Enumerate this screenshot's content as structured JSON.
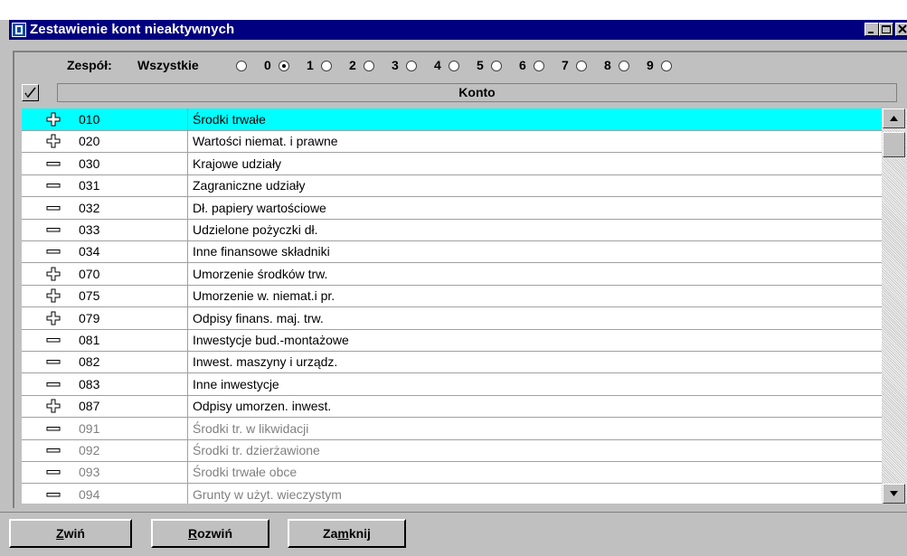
{
  "window": {
    "title": "Zestawienie kont nieaktywnych"
  },
  "filter": {
    "label": "Zespół:",
    "options": [
      {
        "label": "Wszystkie",
        "selected": false
      },
      {
        "label": "0",
        "selected": true
      },
      {
        "label": "1",
        "selected": false
      },
      {
        "label": "2",
        "selected": false
      },
      {
        "label": "3",
        "selected": false
      },
      {
        "label": "4",
        "selected": false
      },
      {
        "label": "5",
        "selected": false
      },
      {
        "label": "6",
        "selected": false
      },
      {
        "label": "7",
        "selected": false
      },
      {
        "label": "8",
        "selected": false
      },
      {
        "label": "9",
        "selected": false
      }
    ]
  },
  "table": {
    "header": "Konto",
    "rows": [
      {
        "icon": "expand-plus-icon",
        "code": "010",
        "name": "Środki trwałe",
        "selected": true,
        "inactive": false
      },
      {
        "icon": "expand-plus-icon",
        "code": "020",
        "name": "Wartości niemat. i prawne",
        "selected": false,
        "inactive": false
      },
      {
        "icon": "leaf-dash-icon",
        "code": "030",
        "name": "Krajowe udziały",
        "selected": false,
        "inactive": false
      },
      {
        "icon": "leaf-dash-icon",
        "code": "031",
        "name": "Zagraniczne udziały",
        "selected": false,
        "inactive": false
      },
      {
        "icon": "leaf-dash-icon",
        "code": "032",
        "name": "Dł. papiery wartościowe",
        "selected": false,
        "inactive": false
      },
      {
        "icon": "leaf-dash-icon",
        "code": "033",
        "name": "Udzielone pożyczki dł.",
        "selected": false,
        "inactive": false
      },
      {
        "icon": "leaf-dash-icon",
        "code": "034",
        "name": "Inne finansowe składniki",
        "selected": false,
        "inactive": false
      },
      {
        "icon": "expand-plus-icon",
        "code": "070",
        "name": "Umorzenie środków trw.",
        "selected": false,
        "inactive": false
      },
      {
        "icon": "expand-plus-icon",
        "code": "075",
        "name": "Umorzenie w. niemat.i pr.",
        "selected": false,
        "inactive": false
      },
      {
        "icon": "expand-plus-icon",
        "code": "079",
        "name": "Odpisy finans. maj. trw.",
        "selected": false,
        "inactive": false
      },
      {
        "icon": "leaf-dash-icon",
        "code": "081",
        "name": "Inwestycje bud.-montażowe",
        "selected": false,
        "inactive": false
      },
      {
        "icon": "leaf-dash-icon",
        "code": "082",
        "name": "Inwest. maszyny i urządz.",
        "selected": false,
        "inactive": false
      },
      {
        "icon": "leaf-dash-icon",
        "code": "083",
        "name": "Inne inwestycje",
        "selected": false,
        "inactive": false
      },
      {
        "icon": "expand-plus-icon",
        "code": "087",
        "name": "Odpisy umorzen. inwest.",
        "selected": false,
        "inactive": false
      },
      {
        "icon": "leaf-dash-icon",
        "code": "091",
        "name": "Środki tr. w likwidacji",
        "selected": false,
        "inactive": true
      },
      {
        "icon": "leaf-dash-icon",
        "code": "092",
        "name": "Środki tr. dzierżawione",
        "selected": false,
        "inactive": true
      },
      {
        "icon": "leaf-dash-icon",
        "code": "093",
        "name": "Środki trwałe obce",
        "selected": false,
        "inactive": true
      },
      {
        "icon": "leaf-dash-icon",
        "code": "094",
        "name": "Grunty w użyt. wieczystym",
        "selected": false,
        "inactive": true
      }
    ]
  },
  "buttons": {
    "collapse": {
      "pre": "",
      "key": "Z",
      "post": "wiń"
    },
    "expand": {
      "pre": "",
      "key": "R",
      "post": "ozwiń"
    },
    "close": {
      "pre": "Za",
      "key": "m",
      "post": "knij"
    }
  },
  "colors": {
    "title_bar": "#000080",
    "selection": "#00ffff",
    "face": "#c0c0c0",
    "inactive_text": "#808080"
  }
}
